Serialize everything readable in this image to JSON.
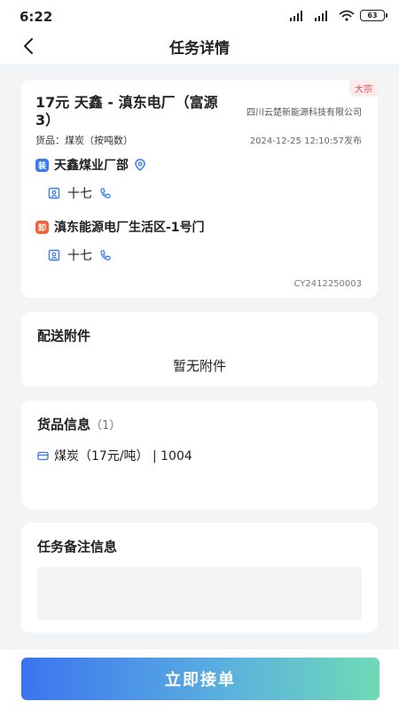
{
  "status_bar": {
    "time": "6:22",
    "battery": "63"
  },
  "nav": {
    "title": "任务详情"
  },
  "task": {
    "tag": "大宗",
    "route_title": "17元 天鑫 - 滇东电厂（富源3）",
    "company": "四川云楚新能源科技有限公司",
    "goods_line": "货品：煤炭（按吨数）",
    "publish_time": "2024-12-25 12:10:57发布",
    "load_badge": "装",
    "load_place": "天鑫煤业厂部",
    "load_contact": "十七",
    "unload_badge": "卸",
    "unload_place": "滇东能源电厂生活区-1号门",
    "unload_contact": "十七",
    "order_no": "CY2412250003"
  },
  "attachments": {
    "title": "配送附件",
    "empty_text": "暂无附件"
  },
  "goods_info": {
    "title": "货品信息",
    "count": "（1）",
    "items": [
      {
        "text": "煤炭（17元/吨） | 1004"
      }
    ]
  },
  "remarks": {
    "title": "任务备注信息",
    "value": ""
  },
  "footer": {
    "accept_label": "立即接单"
  },
  "colors": {
    "accent": "#3b74ef",
    "load": "#3a7af0",
    "unload": "#f06336",
    "tag": "#e5484d"
  }
}
